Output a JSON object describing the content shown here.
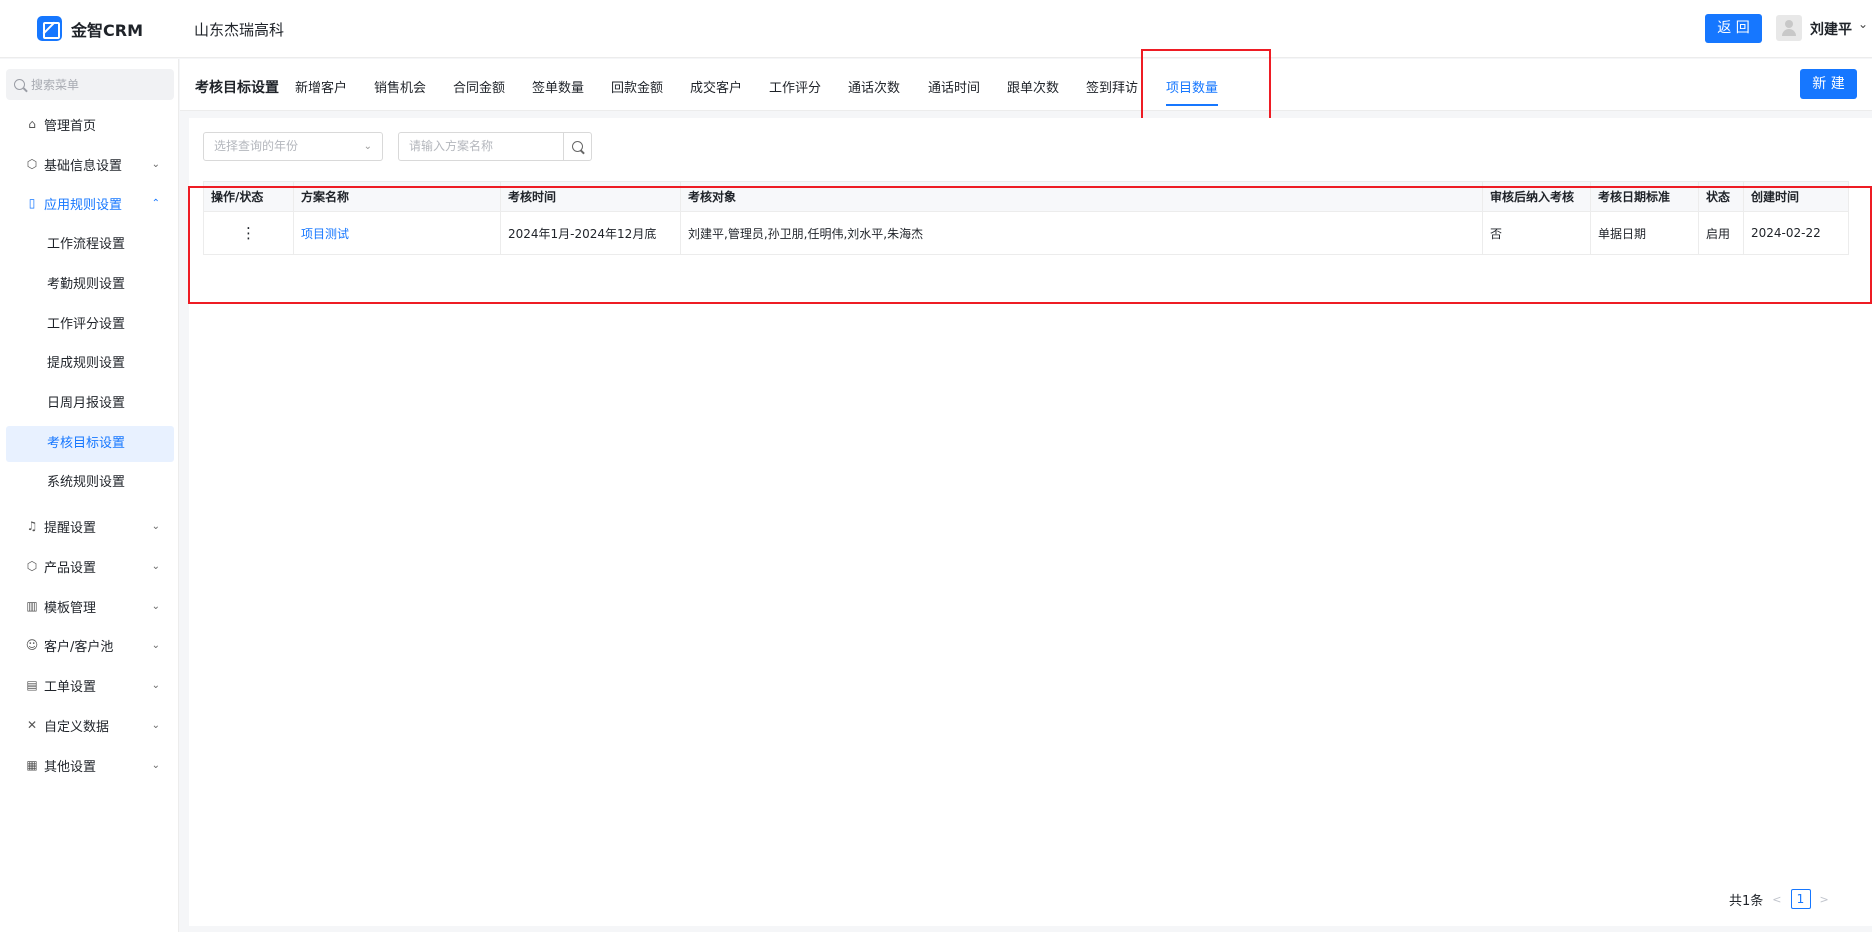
{
  "app": {
    "logo_text": "金智CRM",
    "company": "山东杰瑞高科"
  },
  "topbar": {
    "back_label": "返 回",
    "username": "刘建平"
  },
  "sidebar": {
    "search_placeholder": "搜索菜单",
    "items": [
      {
        "label": "管理首页",
        "icon": "home-icon"
      },
      {
        "label": "基础信息设置",
        "icon": "box-icon"
      },
      {
        "label": "应用规则设置",
        "icon": "document-icon"
      },
      {
        "label": "提醒设置",
        "icon": "bell-icon"
      },
      {
        "label": "产品设置",
        "icon": "cube-icon"
      },
      {
        "label": "模板管理",
        "icon": "template-icon"
      },
      {
        "label": "客户/客户池",
        "icon": "user-icon"
      },
      {
        "label": "工单设置",
        "icon": "ticket-icon"
      },
      {
        "label": "自定义数据",
        "icon": "tools-icon"
      },
      {
        "label": "其他设置",
        "icon": "grid-icon"
      }
    ],
    "sub_items": [
      "工作流程设置",
      "考勤规则设置",
      "工作评分设置",
      "提成规则设置",
      "日周月报设置",
      "考核目标设置",
      "系统规则设置"
    ]
  },
  "tabbar": {
    "title": "考核目标设置",
    "tabs": [
      "新增客户",
      "销售机会",
      "合同金额",
      "签单数量",
      "回款金额",
      "成交客户",
      "工作评分",
      "通话次数",
      "通话时间",
      "跟单次数",
      "签到拜访",
      "项目数量"
    ],
    "active_tab": "项目数量",
    "new_label": "新 建"
  },
  "filters": {
    "year_placeholder": "选择查询的年份",
    "name_placeholder": "请输入方案名称"
  },
  "table": {
    "columns": [
      "操作/状态",
      "方案名称",
      "考核时间",
      "考核对象",
      "审核后纳入考核",
      "考核日期标准",
      "状态",
      "创建时间"
    ],
    "rows": [
      {
        "ops": "⋮",
        "name": "项目测试",
        "period": "2024年1月-2024年12月底",
        "targets": "刘建平,管理员,孙卫朋,任明伟,刘水平,朱海杰",
        "include_after_review": "否",
        "date_standard": "单据日期",
        "status": "启用",
        "created": "2024-02-22"
      }
    ]
  },
  "pagination": {
    "total": "共1条",
    "current": "1"
  },
  "colors": {
    "accent": "#1677ff",
    "highlight_box": "#ee1c24"
  }
}
